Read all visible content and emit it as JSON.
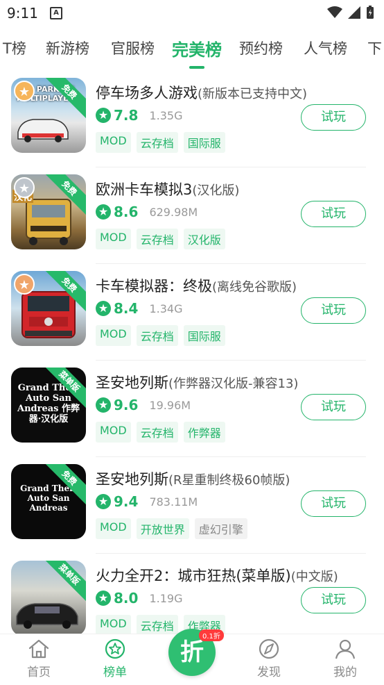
{
  "status": {
    "time": "9:11",
    "notif_glyph": "A"
  },
  "tabs": [
    {
      "label": "T榜"
    },
    {
      "label": "新游榜"
    },
    {
      "label": "官服榜"
    },
    {
      "label": "完美榜"
    },
    {
      "label": "预约榜"
    },
    {
      "label": "人气榜"
    },
    {
      "label": "下"
    }
  ],
  "accent": "#23b46a",
  "games": [
    {
      "name": "停车场多人游戏",
      "sub": "(新版本已支持中文)",
      "score": "7.8",
      "size": "1.35G",
      "tags": [
        "MOD",
        "云存档",
        "国际服"
      ],
      "ribbon": "免费",
      "medal": "gold",
      "action": "试玩",
      "art_text": "CAR PARKING MULTIPLAYER"
    },
    {
      "name": "欧洲卡车模拟3",
      "sub": "(汉化版)",
      "score": "8.6",
      "size": "629.98M",
      "tags": [
        "MOD",
        "云存档",
        "汉化版"
      ],
      "ribbon": "免费",
      "medal": "silver",
      "action": "试玩",
      "art_text": "汉化"
    },
    {
      "name": "卡车模拟器：终极",
      "sub": "(离线免谷歌版)",
      "score": "8.4",
      "size": "1.34G",
      "tags": [
        "MOD",
        "云存档",
        "国际服"
      ],
      "ribbon": "免费",
      "medal": "bronze",
      "action": "试玩",
      "art_text": ""
    },
    {
      "name": "圣安地列斯",
      "sub": "(作弊器汉化版-兼容13)",
      "score": "9.6",
      "size": "19.96M",
      "tags": [
        "MOD",
        "云存档",
        "作弊器"
      ],
      "ribbon": "菜单版",
      "medal": "",
      "action": "试玩",
      "art_text": "Grand Theft Auto San Andreas 作弊器·汉化版"
    },
    {
      "name": "圣安地列斯",
      "sub": "(R星重制终极60帧版)",
      "score": "9.4",
      "size": "783.11M",
      "tags": [
        "MOD",
        "开放世界",
        "虚幻引擎"
      ],
      "ribbon": "免费",
      "medal": "",
      "action": "试玩",
      "art_text": "Grand Theft Auto San Andreas"
    },
    {
      "name": "火力全开2：城市狂热(菜单版)",
      "sub": "(中文版)",
      "score": "8.0",
      "size": "1.19G",
      "tags": [
        "MOD",
        "云存档",
        "作弊器"
      ],
      "ribbon": "菜单版",
      "medal": "",
      "action": "试玩",
      "art_text": ""
    }
  ],
  "bottom_nav": [
    {
      "label": "首页",
      "icon": "home-icon"
    },
    {
      "label": "榜单",
      "icon": "star-circle-icon"
    },
    {
      "label": "折",
      "badge": "0.1折",
      "icon": "discount-icon"
    },
    {
      "label": "发现",
      "icon": "compass-icon"
    },
    {
      "label": "我的",
      "icon": "user-icon"
    }
  ]
}
